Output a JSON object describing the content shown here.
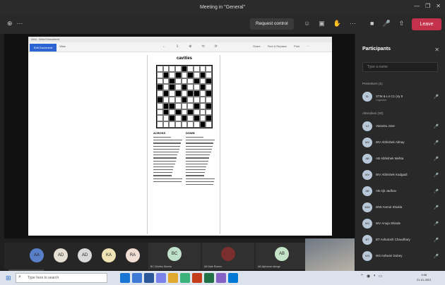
{
  "window": {
    "title": "Meeting in \"General\"",
    "controls": [
      "—",
      "❐",
      "✕"
    ]
  },
  "toolbar": {
    "left_icons": [
      "⊕",
      "···"
    ],
    "request_control": "Request control",
    "center_icons": [
      "☺",
      "▣",
      "✋",
      "···"
    ],
    "right_icons": [
      "■",
      "🎤",
      "⇧"
    ],
    "leave": "Leave",
    "leave_color": "#c4314b"
  },
  "document": {
    "titlebar": "Grid - Word Document",
    "primary_button": "Edit Document",
    "view": "View",
    "mid_icons": [
      "←",
      "⇩",
      "⊕",
      "⟲",
      "⟳"
    ],
    "right_items": [
      "Share",
      "Find & Replace",
      "Print",
      "⋯"
    ],
    "puzzle_title": "cavities",
    "grid": [
      "000010000",
      "010101010",
      "001000101",
      "101010010",
      "010101101",
      "100010000",
      "011000101",
      "010101000",
      "001010101",
      "000000010"
    ],
    "across_header": "ACROSS",
    "down_header": "DOWN",
    "across_lines": 16,
    "down_lines": 17
  },
  "share_label": "Chinthu is presenting",
  "avatars": [
    {
      "initials": "AA",
      "color": "#5a7fc9"
    },
    {
      "initials": "AD",
      "color": "#e5e0d3"
    },
    {
      "initials": "AD",
      "color": "#d9d9d9"
    },
    {
      "initials": "KA",
      "color": "#efe2b5"
    },
    {
      "initials": "RA",
      "color": "#f0ddd3"
    }
  ],
  "tiles": [
    {
      "initials": "BC",
      "label": "BC Chinthu Sheela",
      "color": "#bfe0c9"
    },
    {
      "initials": "",
      "label": "AB Dale Rowen",
      "color": "#7a2e2e"
    },
    {
      "initials": "AB",
      "label": "AB Alphonse Ideoge",
      "color": "#c4e3c6"
    }
  ],
  "participants_panel": {
    "title": "Participants",
    "close": "✕",
    "search_placeholder": "Type a name",
    "presenters_label": "Presenters (1)",
    "presenter": {
      "name": "STM & L4 C1 (4y 9",
      "sub": "Organizer",
      "initials": "SL"
    },
    "attendees_label": "Attendees (30)",
    "attendees": [
      {
        "name": "Vasantu Jose",
        "initials": "VJ"
      },
      {
        "name": "WV Abhishek Abhay",
        "initials": "WV"
      },
      {
        "name": "AB Abhishek Mehta",
        "initials": "AB"
      },
      {
        "name": "WV Abhishek Kadgadi",
        "initials": "WV"
      },
      {
        "name": "AB Ajit Jadhav",
        "initials": "AB"
      },
      {
        "name": "WW Anmol Shukla",
        "initials": "WW"
      },
      {
        "name": "WV Anuja Shinde",
        "initials": "WV"
      },
      {
        "name": "BT Ashutosh Chaudhary",
        "initials": "BT"
      },
      {
        "name": "W3 Ashwini Dubey",
        "initials": "W3"
      }
    ]
  },
  "taskbar": {
    "search_placeholder": "Type here to search",
    "apps": [
      "#1976d2",
      "#3d7bd4",
      "#2b579a",
      "#7b83eb",
      "#e0a82e",
      "#3bb37a",
      "#c43e1c",
      "#217346",
      "#8661c5",
      "#0078d4"
    ],
    "time": "9:58",
    "date": "21-01-2021"
  }
}
